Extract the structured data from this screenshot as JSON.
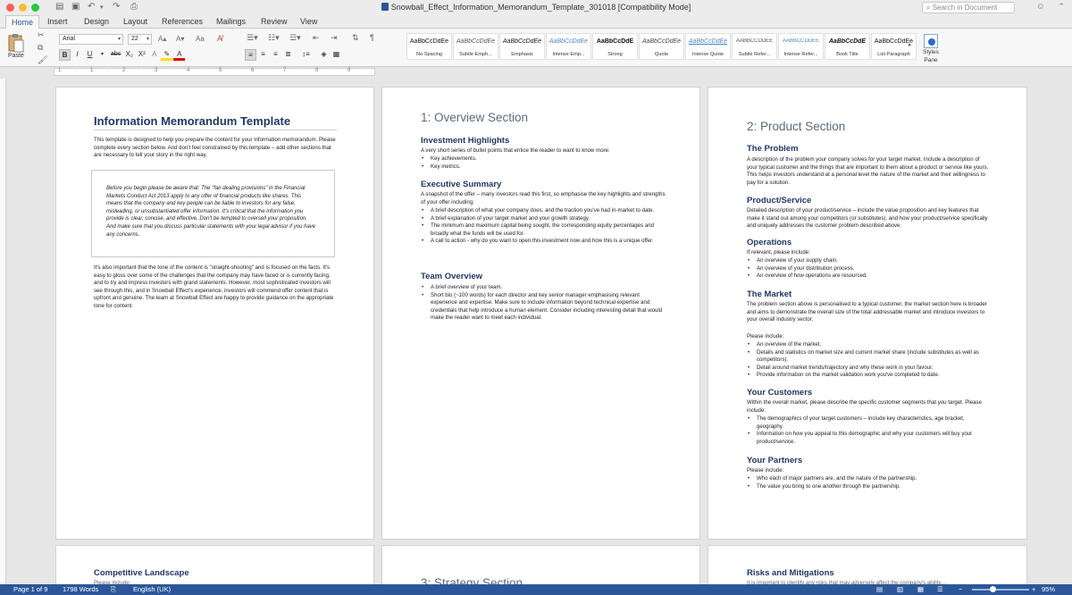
{
  "window": {
    "title": "Snowball_Effect_Information_Memorandum_Template_301018 [Compatibility Mode]",
    "search_placeholder": "Search in Document"
  },
  "ribbon_tabs": [
    "Home",
    "Insert",
    "Design",
    "Layout",
    "References",
    "Mailings",
    "Review",
    "View"
  ],
  "ribbon": {
    "paste_label": "Paste",
    "font_name": "Arial",
    "font_size": "22",
    "styles_pane_line1": "Styles",
    "styles_pane_line2": "Pane",
    "styles": [
      {
        "sample": "AaBbCcDdEe",
        "name": "No Spacing"
      },
      {
        "sample": "AaBbCcDdEe",
        "name": "Subtle Emph..."
      },
      {
        "sample": "AaBbCcDdEe",
        "name": "Emphasis"
      },
      {
        "sample": "AaBbCcDdEe",
        "name": "Intense Emp..."
      },
      {
        "sample": "AaBbCcDdE",
        "name": "Strong"
      },
      {
        "sample": "AaBbCcDdEe",
        "name": "Quote"
      },
      {
        "sample": "AaBbCcDdEe",
        "name": "Intense Quote"
      },
      {
        "sample": "AABBCCDDEE",
        "name": "Subtle Refer..."
      },
      {
        "sample": "AABBCCDDEE",
        "name": "Intense Refer..."
      },
      {
        "sample": "AaBbCcDdE",
        "name": "Book Title"
      },
      {
        "sample": "AaBbCcDdEe",
        "name": "List Paragraph"
      }
    ]
  },
  "page1": {
    "title": "Information Memorandum Template",
    "intro": "This template is designed to help you prepare the content for your information memorandum. Please complete every section below. And don't feel constrained by this template – add other sections that are necessary to tell your story in the right way.",
    "quote": "Before you begin please be aware that: The \"fair dealing provisions\" in the Financial Markets Conduct Act 2013 apply to any offer of financial products like shares. This means that the company and key people can be liable to investors for any false, misleading, or unsubstantiated offer information. It's critical that the information you provide is clear, concise, and effective. Don't be tempted to oversell your proposition. And make sure that you discuss particular statements with your legal advisor if you have any concerns.",
    "body": "It's also important that the tone of the content is \"straight-shooting\" and is focused on the facts. It's easy to gloss over some of the challenges that the company may have faced or is currently facing, and to try and impress investors with grand statements. However, most sophisticated investors will see through this, and in Snowball Effect's experience, investors will commend offer content that is upfront and genuine. The team at Snowball Effect are happy to provide guidance on the appropriate tone for content."
  },
  "page2": {
    "title": "1: Overview Section",
    "h_investment": "Investment Highlights",
    "investment_text": "A very short series of bullet points that entice the reader to want to know more:",
    "investment_bullets": [
      "Key achievements.",
      "Key metrics."
    ],
    "h_exec": "Executive Summary",
    "exec_text": "A snapshot of the offer – many investors read this first, so emphasise the key highlights and strengths of your offer including:",
    "exec_bullets": [
      "A brief description of what your company does, and the traction you've had in-market to date.",
      "A brief explanation of your target market and your growth strategy.",
      "The minimum and maximum capital being sought, the corresponding equity percentages and broadly what the funds will be used for.",
      "A call to action - why do you want to open this investment now and how this is a unique offer."
    ],
    "h_team": "Team Overview",
    "team_bullets": [
      "A brief overview of your team.",
      "Short bio (~100 words) for each director and key senior manager emphasising relevant experience and expertise. Make sure to include information beyond technical expertise and credentials that help introduce a human element. Consider including interesting detail that would make the reader want to meet each individual."
    ]
  },
  "page3": {
    "title": "2: Product Section",
    "h_problem": "The Problem",
    "problem_text": "A description of the problem your company solves for your target market. Include a description of your typical customer and the things that are important to them about a product or service like yours. This helps investors understand at a personal level the nature of the market and their willingness to pay for a solution.",
    "h_product": "Product/Service",
    "product_text": "Detailed description of your product/service – include the value proposition and key features that make it stand out among your competitors (or substitutes), and how your product/service specifically and uniquely addresses the customer problem described above.",
    "h_operations": "Operations",
    "operations_text": "If relevant, please include:",
    "operations_bullets": [
      "An overview of your supply chain.",
      "An overview of your distribution process.",
      "An overview of how operations are resourced."
    ],
    "h_market": "The Market",
    "market_text": "The problem section above is personalised to a typical customer, the market section here is broader and aims to demonstrate the overall size of the total addressable market and introduce investors to your overall industry sector.",
    "market_text2": "Please include:",
    "market_bullets": [
      "An overview of the market.",
      "Details and statistics on market size and current market share (include substitutes as well as competitors).",
      "Detail around market trends/trajectory and why these work in your favour.",
      "Provide information on the market validation work you've completed to date."
    ],
    "h_customers": "Your Customers",
    "customers_text": "Within the overall market, please describe the specific customer segments that you target. Please include:",
    "customers_bullets": [
      "The demographics of your target customers – include key characteristics, age bracket, geography.",
      "Information on how you appeal to this demographic and why your customers will buy your product/service."
    ],
    "h_partners": "Your Partners",
    "partners_text": "Please include:",
    "partners_bullets": [
      "Who each of major partners are, and the nature of the partnership.",
      "The value you bring to one another through the partnership."
    ]
  },
  "page4": {
    "heading": "Competitive Landscape",
    "partial": "Please include:"
  },
  "page5": {
    "heading": "3: Strategy Section"
  },
  "page6": {
    "heading": "Risks and Mitigations",
    "partial": "It is important to identify any risks that may adversely affect the company's ability..."
  },
  "status": {
    "page": "Page 1 of 9",
    "words": "1798 Words",
    "language": "English (UK)",
    "zoom": "95%"
  }
}
